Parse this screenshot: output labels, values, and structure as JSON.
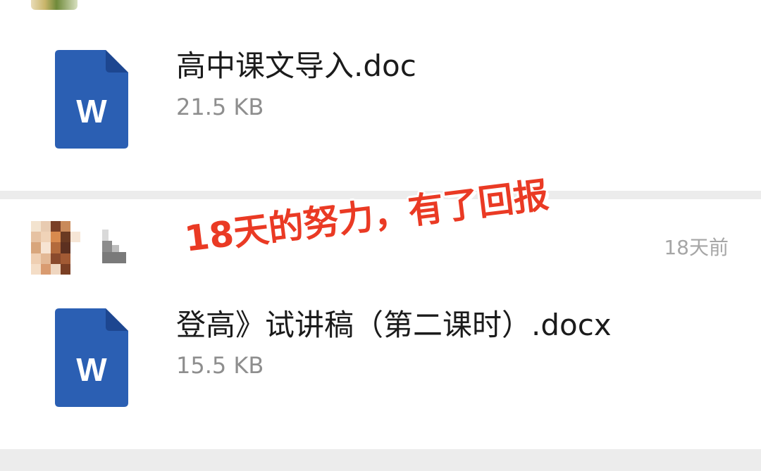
{
  "files": [
    {
      "name": "高中课文导入.doc",
      "size": "21.5 KB",
      "icon": "word-document-icon",
      "icon_letter": "W"
    },
    {
      "name": "登高》试讲稿（第二课时）.docx",
      "size": "15.5 KB",
      "icon": "word-document-icon",
      "icon_letter": "W"
    }
  ],
  "message_meta": {
    "time_ago": "18天前"
  },
  "overlay": {
    "caption": "18天的努力，有了回报",
    "color": "#ea3a24"
  },
  "colors": {
    "word_blue": "#2b5fb3",
    "word_fold": "#1d4690",
    "separator": "#ececec",
    "size_text": "#8e8e8e",
    "time_text": "#a6a6a6"
  }
}
